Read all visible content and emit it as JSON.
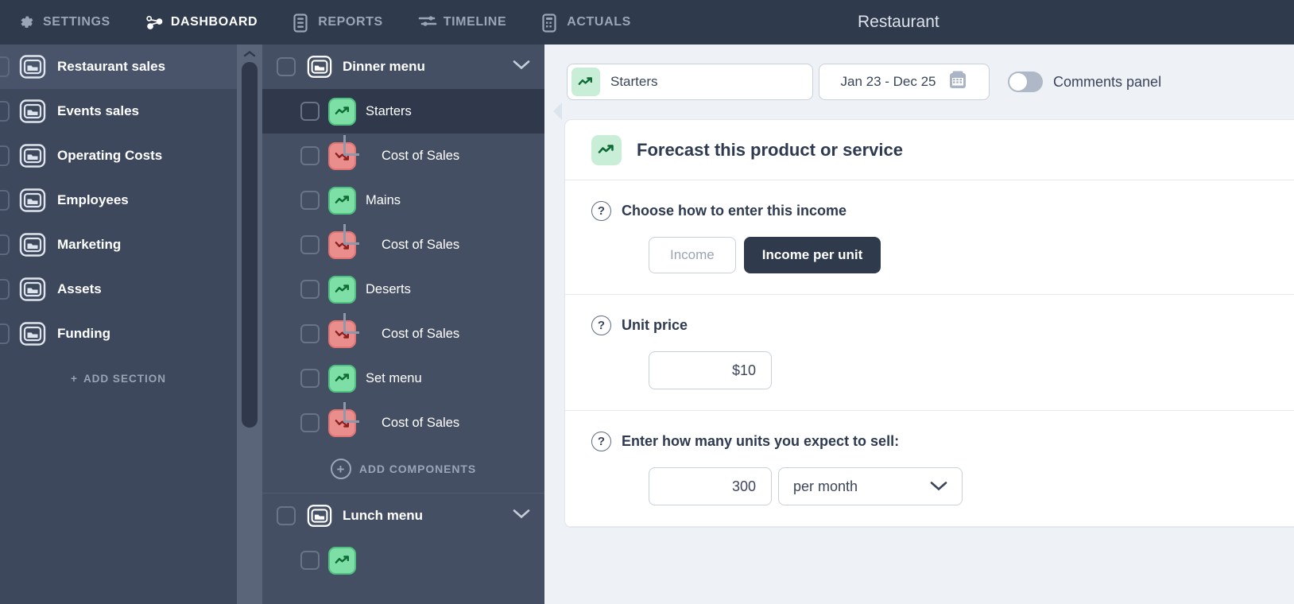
{
  "topnav": {
    "items": [
      {
        "label": "Settings",
        "icon": "gear-icon",
        "active": false
      },
      {
        "label": "Dashboard",
        "icon": "network-icon",
        "active": true
      },
      {
        "label": "Reports",
        "icon": "report-icon",
        "active": false
      },
      {
        "label": "Timeline",
        "icon": "timeline-icon",
        "active": false
      },
      {
        "label": "Actuals",
        "icon": "actuals-icon",
        "active": false
      }
    ],
    "app_title": "Restaurant"
  },
  "sections": {
    "items": [
      {
        "label": "Restaurant sales",
        "selected": true
      },
      {
        "label": "Events sales",
        "selected": false
      },
      {
        "label": "Operating Costs",
        "selected": false
      },
      {
        "label": "Employees",
        "selected": false
      },
      {
        "label": "Marketing",
        "selected": false
      },
      {
        "label": "Assets",
        "selected": false
      },
      {
        "label": "Funding",
        "selected": false
      }
    ],
    "add_label": "ADD SECTION",
    "add_plus": "+"
  },
  "tree": {
    "groups": [
      {
        "label": "Dinner menu",
        "items": [
          {
            "label": "Starters",
            "kind": "up",
            "child": false,
            "selected": true
          },
          {
            "label": "Cost of Sales",
            "kind": "down",
            "child": true,
            "selected": false
          },
          {
            "label": "Mains",
            "kind": "up",
            "child": false,
            "selected": false
          },
          {
            "label": "Cost of Sales",
            "kind": "down",
            "child": true,
            "selected": false
          },
          {
            "label": "Deserts",
            "kind": "up",
            "child": false,
            "selected": false
          },
          {
            "label": "Cost of Sales",
            "kind": "down",
            "child": true,
            "selected": false
          },
          {
            "label": "Set menu",
            "kind": "up",
            "child": false,
            "selected": false
          },
          {
            "label": "Cost of Sales",
            "kind": "down",
            "child": true,
            "selected": false
          }
        ],
        "add_components_label": "ADD COMPONENTS",
        "add_components_plus": "+"
      },
      {
        "label": "Lunch menu",
        "items": [],
        "add_components_label": "",
        "add_components_plus": ""
      }
    ]
  },
  "toolbar": {
    "product_name": "Starters",
    "date_range": "Jan 23 - Dec 25",
    "comments_label": "Comments panel",
    "comments_on": false
  },
  "card": {
    "title": "Forecast this product or service",
    "fields": [
      {
        "label": "Choose how to enter this income",
        "option_a": "Income",
        "option_b": "Income per unit"
      },
      {
        "label": "Unit price",
        "value": "$10"
      },
      {
        "label": "Enter how many units you expect to sell:",
        "value": "300",
        "frequency": "per month"
      }
    ],
    "help_glyph": "?"
  },
  "colors": {
    "nav_bg": "#2f3a4d",
    "sections_bg": "#3e485c",
    "tree_bg": "#454f64",
    "selected_row": "#2f394b",
    "main_bg": "#eef1f5",
    "income_up": "#7ddfa6",
    "income_down": "#e98d8d",
    "accent_dark": "#2f3a4d"
  }
}
